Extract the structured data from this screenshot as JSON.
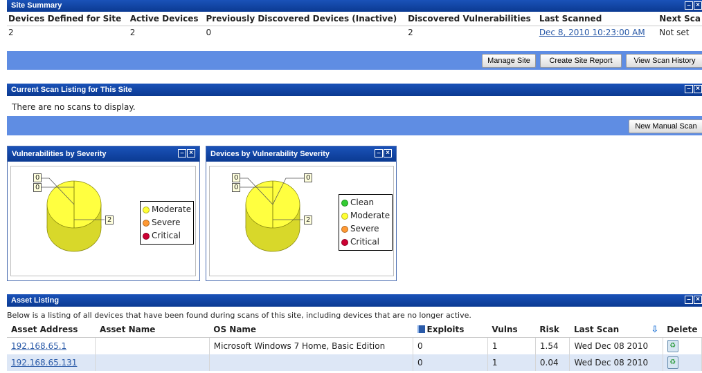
{
  "site_summary": {
    "title": "Site Summary",
    "headers": [
      "Devices Defined for Site",
      "Active Devices",
      "Previously Discovered Devices (Inactive)",
      "Discovered Vulnerabilities",
      "Last Scanned",
      "Next Sca"
    ],
    "values": [
      "2",
      "2",
      "0",
      "2",
      "Dec 8, 2010 10:23:00 AM",
      "Not set"
    ],
    "buttons": {
      "manage": "Manage Site",
      "report": "Create Site Report",
      "history": "View Scan History"
    }
  },
  "scan_listing": {
    "title": "Current Scan Listing for This Site",
    "empty_message": "There are no scans to display.",
    "new_scan_button": "New Manual Scan"
  },
  "vuln_widget": {
    "title": "Vulnerabilities by Severity",
    "legend": [
      {
        "label": "Moderate",
        "color": "#ffff33"
      },
      {
        "label": "Severe",
        "color": "#ff9933"
      },
      {
        "label": "Critical",
        "color": "#cc0033"
      }
    ],
    "labels": [
      "0",
      "0",
      "2"
    ]
  },
  "device_widget": {
    "title": "Devices by Vulnerability Severity",
    "legend": [
      {
        "label": "Clean",
        "color": "#33cc33"
      },
      {
        "label": "Moderate",
        "color": "#ffff33"
      },
      {
        "label": "Severe",
        "color": "#ff9933"
      },
      {
        "label": "Critical",
        "color": "#cc0033"
      }
    ],
    "labels": [
      "0",
      "0",
      "0",
      "2"
    ]
  },
  "asset_listing": {
    "title": "Asset Listing",
    "description": "Below is a listing of all devices that have been found during scans of this site, including devices that are no longer active.",
    "headers": {
      "address": "Asset Address",
      "name": "Asset Name",
      "os": "OS Name",
      "exploits": "Exploits",
      "vulns": "Vulns",
      "risk": "Risk",
      "last_scan": "Last Scan",
      "delete": "Delete"
    },
    "rows": [
      {
        "address": "192.168.65.1",
        "name": "",
        "os": "Microsoft Windows 7 Home, Basic Edition",
        "exploits": "0",
        "vulns": "1",
        "risk": "1.54",
        "last_scan": "Wed Dec 08 2010"
      },
      {
        "address": "192.168.65.131",
        "name": "",
        "os": "",
        "exploits": "0",
        "vulns": "1",
        "risk": "0.04",
        "last_scan": "Wed Dec 08 2010"
      }
    ]
  },
  "window_controls": {
    "minimize": "–",
    "close": "×"
  }
}
